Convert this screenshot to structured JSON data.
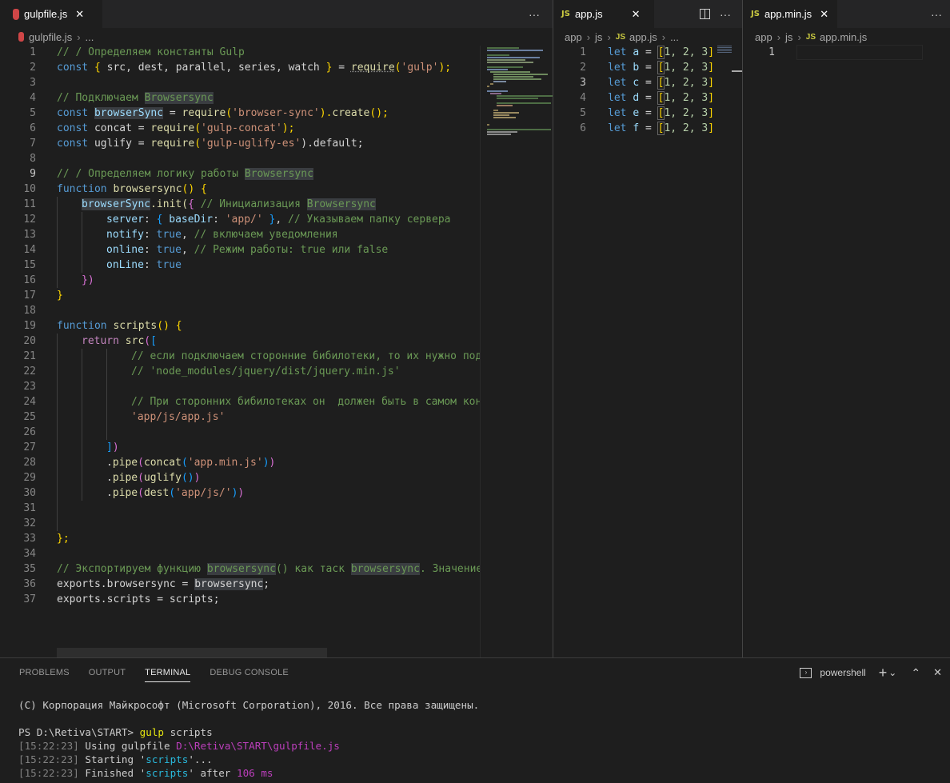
{
  "editor_left": {
    "tab": {
      "icon": "gulp-icon",
      "label": "gulpfile.js",
      "close": "✕"
    },
    "more": "···",
    "breadcrumb": {
      "file": "gulpfile.js",
      "more": "..."
    },
    "lines": [
      {
        "n": "1"
      },
      {
        "n": "2"
      },
      {
        "n": "3"
      },
      {
        "n": "4"
      },
      {
        "n": "5"
      },
      {
        "n": "6"
      },
      {
        "n": "7"
      },
      {
        "n": "8"
      },
      {
        "n": "9"
      },
      {
        "n": "10"
      },
      {
        "n": "11"
      },
      {
        "n": "12"
      },
      {
        "n": "13"
      },
      {
        "n": "14"
      },
      {
        "n": "15"
      },
      {
        "n": "16"
      },
      {
        "n": "17"
      },
      {
        "n": "18"
      },
      {
        "n": "19"
      },
      {
        "n": "20"
      },
      {
        "n": "21"
      },
      {
        "n": "22"
      },
      {
        "n": "23"
      },
      {
        "n": "24"
      },
      {
        "n": "25"
      },
      {
        "n": "26"
      },
      {
        "n": "27"
      },
      {
        "n": "28"
      },
      {
        "n": "29"
      },
      {
        "n": "30"
      },
      {
        "n": "31"
      },
      {
        "n": "32"
      },
      {
        "n": "33"
      },
      {
        "n": "34"
      },
      {
        "n": "35"
      },
      {
        "n": "36"
      },
      {
        "n": "37"
      }
    ],
    "code": {
      "l1": "// / Определяем константы Gulp",
      "l2a": "const",
      "l2b": "{",
      "l2c": " src, dest, parallel, series, watch ",
      "l2d": "}",
      "l2e": " = ",
      "l2f": "require",
      "l2g": "(",
      "l2h": "'gulp'",
      "l2i": ");",
      "l4a": "// Подключаем ",
      "l4b": "Browsersync",
      "l5a": "const",
      "l5b": "browserSync",
      "l5c": " = ",
      "l5d": "require",
      "l5e": "(",
      "l5f": "'browser-sync'",
      "l5g": ").",
      "l5h": "create",
      "l5i": "();",
      "l6a": "const",
      "l6b": " concat = ",
      "l6c": "require",
      "l6d": "(",
      "l6e": "'gulp-concat'",
      "l6f": ");",
      "l7a": "const",
      "l7b": " uglify = ",
      "l7c": "require",
      "l7d": "(",
      "l7e": "'gulp-uglify-es'",
      "l7f": ").default;",
      "l9a": "// / Определяем логику работы ",
      "l9b": "Browsersync",
      "l10a": "function",
      "l10b": "browsersync",
      "l10c": "() {",
      "l11a": "browserSync",
      "l11b": ".init(",
      "l11c": "{",
      "l11d": " // Инициализация ",
      "l11e": "Browsersync",
      "l12a": "server",
      "l12b": ": ",
      "l12c": "{",
      "l12d": " baseDir",
      "l12e": ": ",
      "l12f": "'app/'",
      "l12g": " }",
      "l12h": ", ",
      "l12i": "// Указываем папку сервера",
      "l13a": "notify",
      "l13b": ": ",
      "l13c": "true",
      "l13d": ", ",
      "l13e": "// включаем уведомления",
      "l14a": "online",
      "l14b": ": ",
      "l14c": "true",
      "l14d": ", ",
      "l14e": "// Режим работы: true или false",
      "l15a": "onLine",
      "l15b": ": ",
      "l15c": "true",
      "l16a": "})",
      "l17a": "}",
      "l19a": "function",
      "l19b": "scripts",
      "l19c": "() {",
      "l20a": "return",
      "l20b": "src",
      "l20c": "(",
      "l20d": "[",
      "l21": "// если подключаем сторонние бибилотеки, то их нужно подк",
      "l22": "// 'node_modules/jquery/dist/jquery.min.js'",
      "l24": "// При сторонних бибилотеках он  должен быть в самом кон",
      "l25": "'app/js/app.js'",
      "l27a": "]",
      "l27b": ")",
      "l28a": ".",
      "l28b": "pipe",
      "l28c": "(",
      "l28d": "concat",
      "l28e": "(",
      "l28f": "'app.min.js'",
      "l28g": ")",
      "l28h": ")",
      "l29a": ".",
      "l29b": "pipe",
      "l29c": "(",
      "l29d": "uglify",
      "l29e": "()",
      "l29f": ")",
      "l30a": ".",
      "l30b": "pipe",
      "l30c": "(",
      "l30d": "dest",
      "l30e": "(",
      "l30f": "'app/js/'",
      "l30g": ")",
      "l30h": ")",
      "l33a": "};",
      "l35a": "// Экспортируем функцию ",
      "l35b": "browsersync",
      "l35c": "() как таск ",
      "l35d": "browsersync",
      "l35e": ". Значение",
      "l36a": "exports",
      "l36b": ".browsersync = ",
      "l36c": "browsersync",
      "l36d": ";",
      "l37a": "exports",
      "l37b": ".scripts = ",
      "l37c": "scripts",
      "l37d": ";"
    }
  },
  "editor_mid": {
    "tab": {
      "icon": "JS",
      "label": "app.js",
      "close": "✕"
    },
    "split_icon": "split-editor-icon",
    "more": "···",
    "breadcrumb": {
      "p1": "app",
      "p2": "js",
      "icon": "JS",
      "file": "app.js",
      "more": "..."
    },
    "lines": [
      {
        "n": "1",
        "var": "a"
      },
      {
        "n": "2",
        "var": "b"
      },
      {
        "n": "3",
        "var": "c"
      },
      {
        "n": "4",
        "var": "d"
      },
      {
        "n": "5",
        "var": "e"
      },
      {
        "n": "6",
        "var": "f"
      }
    ],
    "kw": "let",
    "eq": " = ",
    "arr_open": "[",
    "arr_vals": "1, 2, 3",
    "arr_close": "]"
  },
  "editor_right": {
    "tab": {
      "icon": "JS",
      "label": "app.min.js",
      "close": "✕"
    },
    "more": "···",
    "breadcrumb": {
      "p1": "app",
      "p2": "js",
      "icon": "JS",
      "file": "app.min.js"
    },
    "line1": "1"
  },
  "panel": {
    "tabs": [
      "PROBLEMS",
      "OUTPUT",
      "TERMINAL",
      "DEBUG CONSOLE"
    ],
    "active_tab": "TERMINAL",
    "shell": "powershell",
    "plus": "+",
    "chevron": "⌄",
    "maximize": "⌃",
    "close": "✕",
    "terminal": {
      "copyright": "(C) Корпорация Майкрософт (Microsoft Corporation), 2016. Все права защищены.",
      "prompt": "PS D:\\Retiva\\START> ",
      "cmd": "gulp",
      "cmd_arg": " scripts",
      "r1_time": "[15:22:23]",
      "r1_text": " Using gulpfile ",
      "r1_path": "D:\\Retiva\\START\\gulpfile.js",
      "r2_time": "[15:22:23]",
      "r2_text": " Starting '",
      "r2_task": "scripts",
      "r2_end": "'...",
      "r3_time": "[15:22:23]",
      "r3_text": " Finished '",
      "r3_task": "scripts",
      "r3_mid": "' after ",
      "r3_ms": "106 ms"
    }
  }
}
